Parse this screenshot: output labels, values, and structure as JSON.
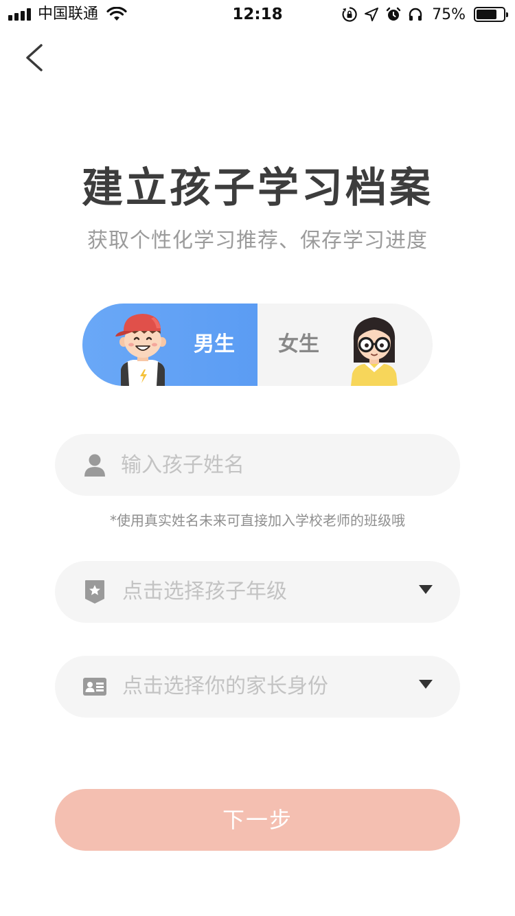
{
  "status_bar": {
    "carrier": "中国联通",
    "time": "12:18",
    "battery_percent_label": "75%",
    "battery_level": 0.75,
    "icons": [
      "signal-icon",
      "wifi-icon",
      "orientation-lock-icon",
      "location-icon",
      "alarm-icon",
      "headphones-icon",
      "battery-icon"
    ]
  },
  "nav": {
    "back_icon": "chevron-left-icon"
  },
  "header": {
    "title": "建立孩子学习档案",
    "subtitle": "获取个性化学习推荐、保存学习进度"
  },
  "gender": {
    "male_label": "男生",
    "female_label": "女生",
    "selected": "male",
    "active_color": "#5b9cf3"
  },
  "form": {
    "name_placeholder": "输入孩子姓名",
    "name_value": "",
    "name_icon": "person-icon",
    "hint": "*使用真实姓名未来可直接加入学校老师的班级哦",
    "grade_placeholder": "点击选择孩子年级",
    "grade_icon": "badge-star-icon",
    "identity_placeholder": "点击选择你的家长身份",
    "identity_icon": "id-card-icon",
    "dropdown_icon": "caret-down-icon"
  },
  "actions": {
    "next_label": "下一步",
    "next_color": "#f4bfb1"
  }
}
